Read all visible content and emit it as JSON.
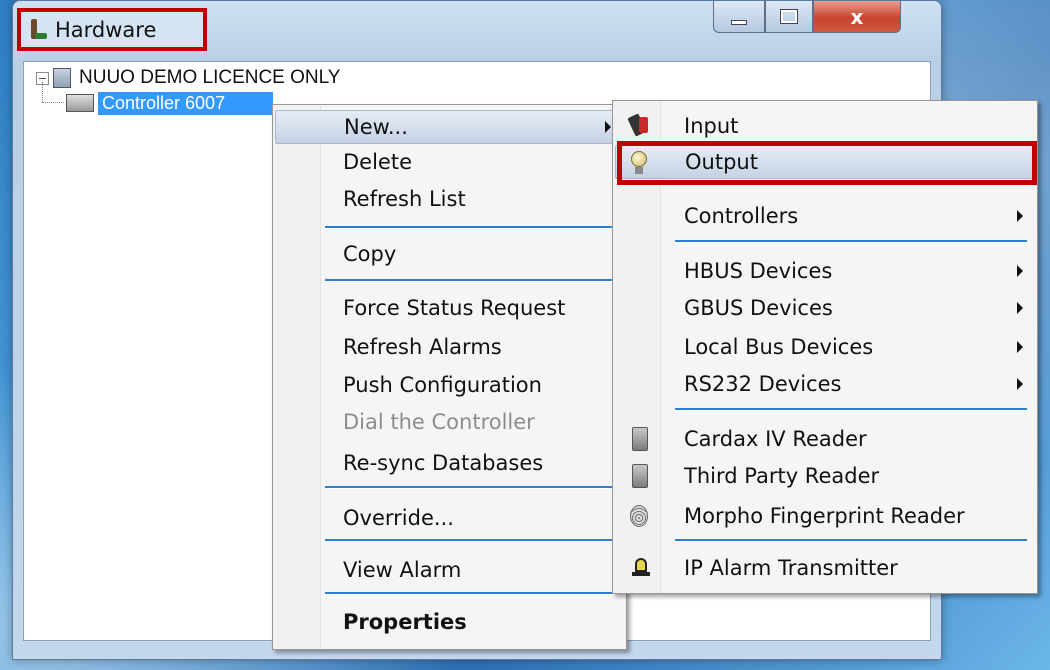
{
  "window": {
    "title": "Hardware",
    "controls": {
      "minimize": "minimize",
      "maximize": "maximize",
      "close": "x"
    }
  },
  "tree": {
    "root_label": "NUUO DEMO LICENCE ONLY",
    "child_label": "Controller 6007"
  },
  "context_menu": {
    "items": [
      {
        "label": "New...",
        "has_submenu": true,
        "highlighted": true
      },
      {
        "label": "Delete"
      },
      {
        "label": "Refresh List"
      },
      {
        "label": "Copy"
      },
      {
        "label": "Force Status Request"
      },
      {
        "label": "Refresh Alarms"
      },
      {
        "label": "Push Configuration"
      },
      {
        "label": "Dial the Controller",
        "disabled": true
      },
      {
        "label": "Re-sync Databases"
      },
      {
        "label": "Override..."
      },
      {
        "label": "View Alarm"
      },
      {
        "label": "Properties",
        "bold": true
      }
    ]
  },
  "submenu": {
    "items": [
      {
        "label": "Input",
        "icon": "plug-icon"
      },
      {
        "label": "Output",
        "icon": "lightbulb-icon",
        "highlighted": true
      },
      {
        "label": "Controllers",
        "has_submenu": true
      },
      {
        "label": "HBUS Devices",
        "has_submenu": true
      },
      {
        "label": "GBUS Devices",
        "has_submenu": true
      },
      {
        "label": "Local Bus Devices",
        "has_submenu": true
      },
      {
        "label": "RS232 Devices",
        "has_submenu": true
      },
      {
        "label": "Cardax IV Reader",
        "icon": "card-reader-icon"
      },
      {
        "label": "Third Party Reader",
        "icon": "card-reader-icon"
      },
      {
        "label": "Morpho Fingerprint Reader",
        "icon": "fingerprint-icon"
      },
      {
        "label": "IP Alarm Transmitter",
        "icon": "alarm-transmitter-icon"
      }
    ]
  },
  "colors": {
    "highlight_border": "#c00000",
    "selection": "#3399ff",
    "separator": "#2f7fd1"
  }
}
